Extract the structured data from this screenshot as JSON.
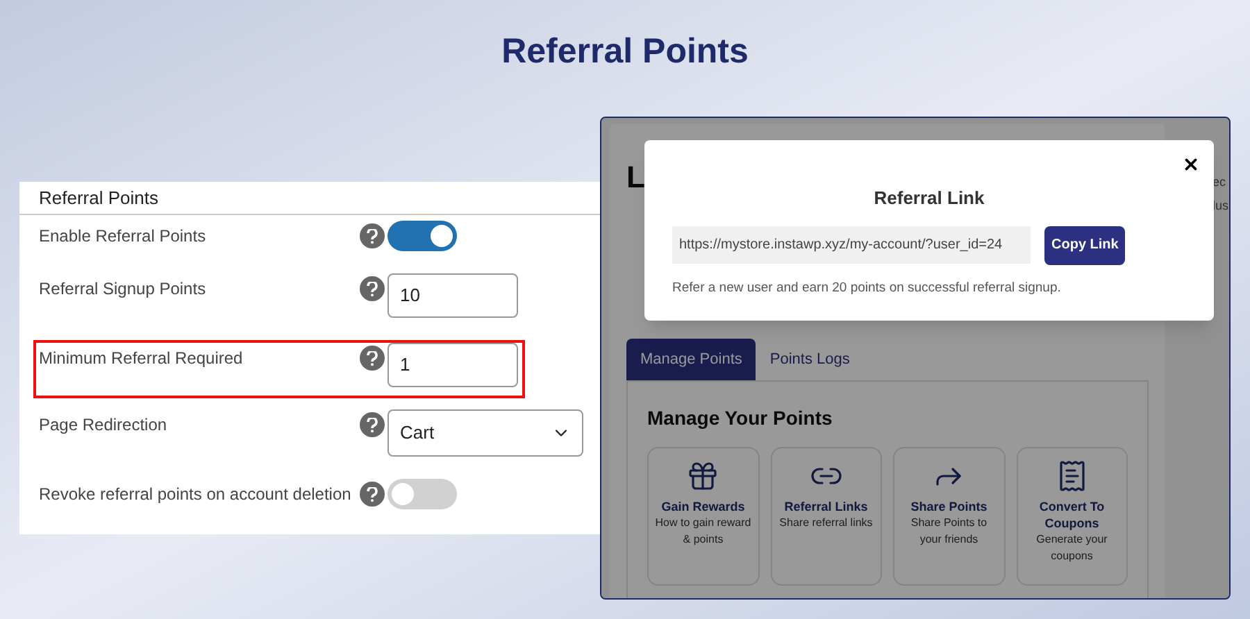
{
  "page_title": "Referral Points",
  "settings_panel": {
    "title": "Referral Points",
    "fields": [
      {
        "kind": "toggle",
        "label": "Enable Referral Points",
        "on": true,
        "highlighted": false
      },
      {
        "kind": "number",
        "label": "Referral Signup Points",
        "value": "10",
        "highlighted": false
      },
      {
        "kind": "number",
        "label": "Minimum Referral Required",
        "value": "1",
        "highlighted": true
      },
      {
        "kind": "select",
        "label": "Page Redirection",
        "value": "Cart",
        "highlighted": false
      },
      {
        "kind": "toggle",
        "label": "Revoke referral points on account deletion",
        "on": false,
        "highlighted": false
      }
    ]
  },
  "account_panel": {
    "heading": "L",
    "side_text": [
      "ec",
      "lus"
    ],
    "tabs": [
      {
        "label": "Manage Points",
        "selected": true
      },
      {
        "label": "Points Logs",
        "selected": false
      }
    ],
    "section_title": "Manage Your Points",
    "cards": [
      {
        "title": "Gain Rewards",
        "subtitle": "How to gain reward & points"
      },
      {
        "title": "Referral Links",
        "subtitle": "Share referral links"
      },
      {
        "title": "Share Points",
        "subtitle": "Share Points to your friends"
      },
      {
        "title": "Convert To Coupons",
        "subtitle": "Generate your coupons"
      }
    ],
    "modal": {
      "title": "Referral Link",
      "url": "https://mystore.instawp.xyz/my-account/?user_id=24",
      "button": "Copy Link",
      "note": "Refer a new user and earn 20 points on successful referral signup."
    }
  }
}
